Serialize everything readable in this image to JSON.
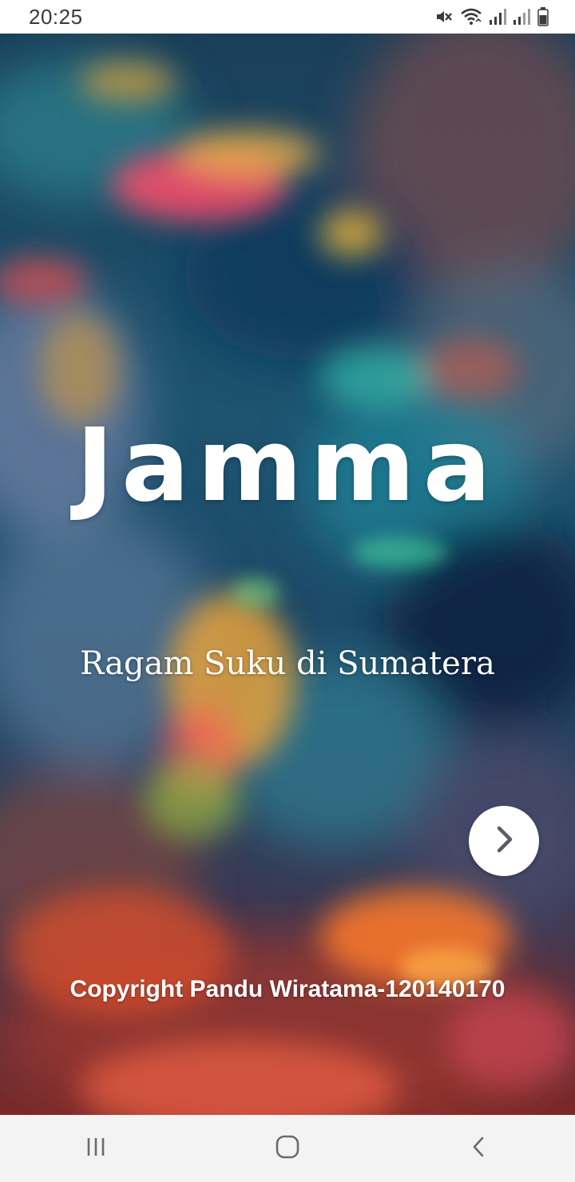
{
  "status_bar": {
    "time": "20:25",
    "icons": [
      "mute-icon",
      "wifi-icon",
      "signal-icon",
      "signal-icon",
      "battery-icon"
    ]
  },
  "splash": {
    "title": "Jamma",
    "subtitle": "Ragam Suku di Sumatera",
    "next_icon": "chevron-right-icon",
    "copyright": "Copyright Pandu Wiratama-120140170"
  },
  "nav_bar": {
    "buttons": [
      "recent-apps-icon",
      "home-icon",
      "back-icon"
    ]
  },
  "colors": {
    "status_bar_bg": "#ffffff",
    "nav_bar_bg": "#f3f3f3",
    "text_on_art": "#ffffff",
    "chevron": "#5a5a6a"
  }
}
